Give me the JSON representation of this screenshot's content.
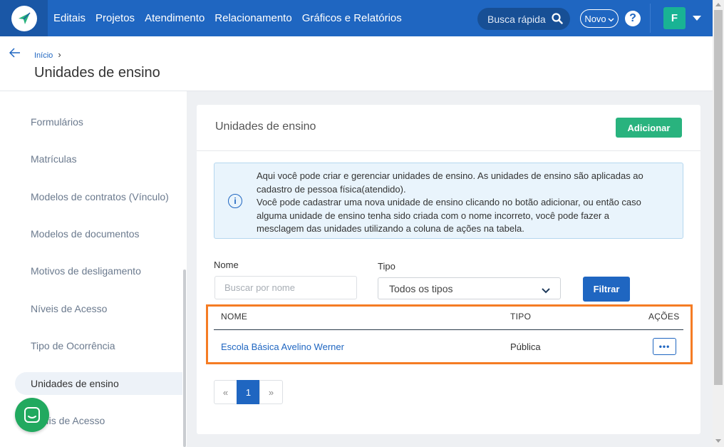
{
  "navbar": {
    "menu": [
      "Editais",
      "Projetos",
      "Atendimento",
      "Relacionamento",
      "Gráficos e Relatórios"
    ],
    "search_label": "Busca rápida",
    "novo_label": "Novo",
    "help_label": "?",
    "avatar_initial": "F"
  },
  "header": {
    "breadcrumb": "Início",
    "breadcrumb_sep": "›",
    "title": "Unidades de ensino"
  },
  "sidebar": {
    "items": [
      {
        "label": "Formulários"
      },
      {
        "label": "Matrículas"
      },
      {
        "label": "Modelos de contratos (Vínculo)"
      },
      {
        "label": "Modelos de documentos"
      },
      {
        "label": "Motivos de desligamento"
      },
      {
        "label": "Níveis de Acesso"
      },
      {
        "label": "Tipo de Ocorrência"
      },
      {
        "label": "Unidades de ensino"
      },
      {
        "label": "Perfis de Acesso"
      }
    ],
    "active_index": 7
  },
  "card": {
    "title": "Unidades de ensino",
    "add_label": "Adicionar",
    "info_lines": [
      "Aqui você pode criar e gerenciar unidades de ensino. As unidades de ensino são aplicadas ao",
      "cadastro de pessoa física(atendido).",
      "Você pode cadastrar uma nova unidade de ensino clicando no botão adicionar, ou então caso",
      "alguma unidade de ensino tenha sido criada com o nome incorreto, você pode fazer a",
      "mesclagem das unidades utilizando a coluna de ações na tabela."
    ],
    "filters": {
      "name_label": "Nome",
      "name_placeholder": "Buscar por nome",
      "type_label": "Tipo",
      "type_value": "Todos os tipos",
      "filter_label": "Filtrar"
    },
    "table": {
      "columns": [
        "NOME",
        "TIPO",
        "AÇÕES"
      ],
      "rows": [
        {
          "name": "Escola Básica Avelino Werner",
          "type": "Pública",
          "action": "•••"
        }
      ]
    },
    "pagination": {
      "prev": "«",
      "current": "1",
      "next": "»"
    }
  },
  "colors": {
    "primary": "#1f66c1",
    "success": "#29b37e",
    "highlight": "#f57c24",
    "chat": "#21a95f"
  }
}
